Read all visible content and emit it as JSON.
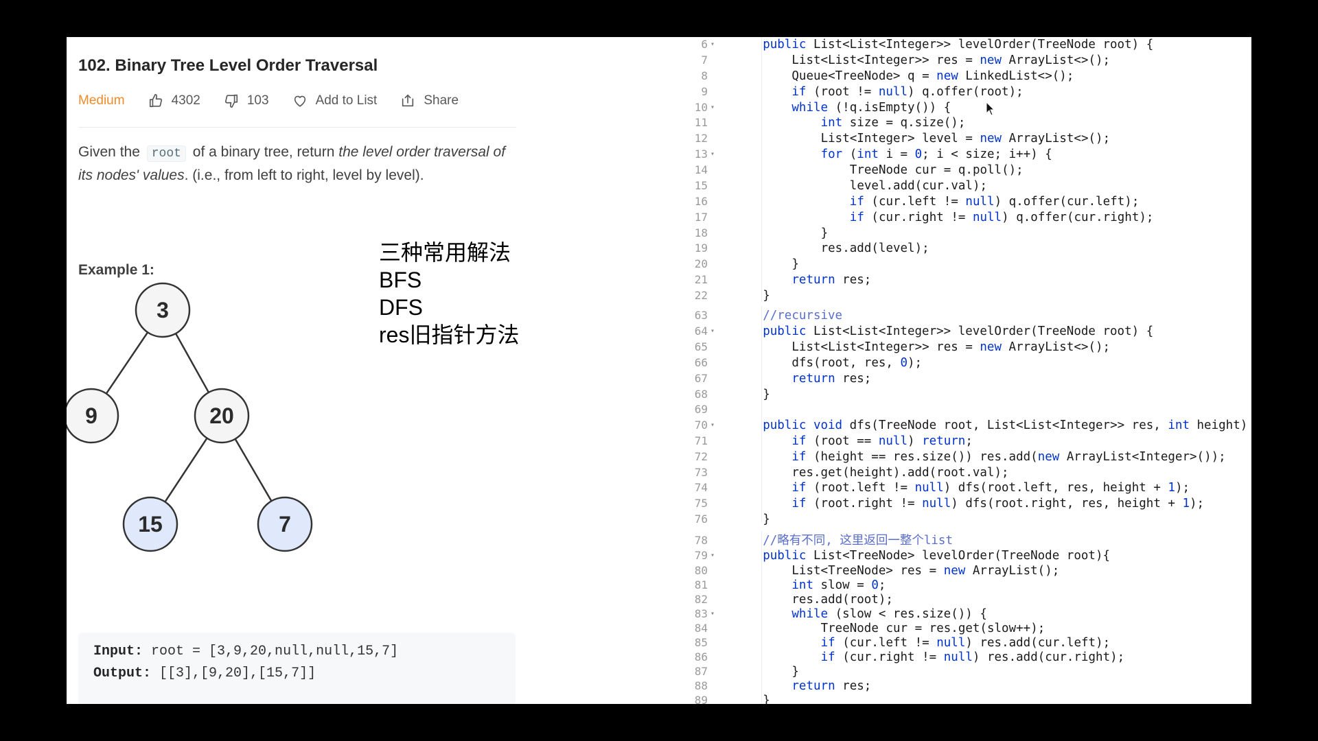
{
  "problem": {
    "title": "102. Binary Tree Level Order Traversal",
    "difficulty": "Medium",
    "likes": "4302",
    "dislikes": "103",
    "add_to_list": "Add to List",
    "share": "Share",
    "desc_1": "Given the",
    "desc_code": "root",
    "desc_2": "of a binary tree, return",
    "desc_italic": "the level order traversal of its nodes' values",
    "desc_3": ". (i.e., from left to right, level by level).",
    "example_label": "Example 1:",
    "input_label": "Input:",
    "input_value": "root = [3,9,20,null,null,15,7]",
    "output_label": "Output:",
    "output_value": "[[3],[9,20],[15,7]]"
  },
  "note": {
    "lines": [
      "三种常用解法",
      "BFS",
      "DFS",
      "res旧指针方法"
    ]
  },
  "tree": {
    "nodes": [
      {
        "value": "3",
        "highlight": false
      },
      {
        "value": "9",
        "highlight": false
      },
      {
        "value": "20",
        "highlight": false
      },
      {
        "value": "15",
        "highlight": true
      },
      {
        "value": "7",
        "highlight": true
      }
    ],
    "edges": [
      [
        0,
        1
      ],
      [
        0,
        2
      ],
      [
        2,
        3
      ],
      [
        2,
        4
      ]
    ],
    "node_fill": "#f5f5f5",
    "highlight_fill": "#dfe9fb",
    "edge_color": "#333333"
  },
  "code": {
    "colors": {
      "keyword": "#0033cc",
      "comment": "#5a6ecc",
      "line_number": "#9a9a9a"
    },
    "lines": [
      {
        "n": "6",
        "fold": true,
        "indent": 4,
        "text": "public List<List<Integer>> levelOrder(TreeNode root) {"
      },
      {
        "n": "7",
        "fold": false,
        "indent": 8,
        "text": "List<List<Integer>> res = new ArrayList<>();"
      },
      {
        "n": "8",
        "fold": false,
        "indent": 8,
        "text": "Queue<TreeNode> q = new LinkedList<>();"
      },
      {
        "n": "9",
        "fold": false,
        "indent": 8,
        "text": "if (root != null) q.offer(root);"
      },
      {
        "n": "10",
        "fold": true,
        "indent": 8,
        "text": "while (!q.isEmpty()) {"
      },
      {
        "n": "11",
        "fold": false,
        "indent": 12,
        "text": "int size = q.size();"
      },
      {
        "n": "12",
        "fold": false,
        "indent": 12,
        "text": "List<Integer> level = new ArrayList<>();"
      },
      {
        "n": "13",
        "fold": true,
        "indent": 12,
        "text": "for (int i = 0; i < size; i++) {"
      },
      {
        "n": "14",
        "fold": false,
        "indent": 16,
        "text": "TreeNode cur = q.poll();"
      },
      {
        "n": "15",
        "fold": false,
        "indent": 16,
        "text": "level.add(cur.val);"
      },
      {
        "n": "16",
        "fold": false,
        "indent": 16,
        "text": "if (cur.left != null) q.offer(cur.left);"
      },
      {
        "n": "17",
        "fold": false,
        "indent": 16,
        "text": "if (cur.right != null) q.offer(cur.right);"
      },
      {
        "n": "18",
        "fold": false,
        "indent": 12,
        "text": "}"
      },
      {
        "n": "19",
        "fold": false,
        "indent": 12,
        "text": "res.add(level);"
      },
      {
        "n": "20",
        "fold": false,
        "indent": 8,
        "text": "}"
      },
      {
        "n": "21",
        "fold": false,
        "indent": 8,
        "text": "return res;"
      },
      {
        "n": "22",
        "fold": false,
        "indent": 4,
        "text": "}"
      },
      {
        "n": "63",
        "fold": false,
        "indent": 4,
        "text": "//recursive"
      },
      {
        "n": "64",
        "fold": true,
        "indent": 4,
        "text": "public List<List<Integer>> levelOrder(TreeNode root) {"
      },
      {
        "n": "65",
        "fold": false,
        "indent": 8,
        "text": "List<List<Integer>> res = new ArrayList<>();"
      },
      {
        "n": "66",
        "fold": false,
        "indent": 8,
        "text": "dfs(root, res, 0);"
      },
      {
        "n": "67",
        "fold": false,
        "indent": 8,
        "text": "return res;"
      },
      {
        "n": "68",
        "fold": false,
        "indent": 4,
        "text": "}"
      },
      {
        "n": "69",
        "fold": false,
        "indent": 0,
        "text": ""
      },
      {
        "n": "70",
        "fold": true,
        "indent": 4,
        "text": "public void dfs(TreeNode root, List<List<Integer>> res, int height) {"
      },
      {
        "n": "71",
        "fold": false,
        "indent": 8,
        "text": "if (root == null) return;"
      },
      {
        "n": "72",
        "fold": false,
        "indent": 8,
        "text": "if (height == res.size()) res.add(new ArrayList<Integer>());"
      },
      {
        "n": "73",
        "fold": false,
        "indent": 8,
        "text": "res.get(height).add(root.val);"
      },
      {
        "n": "74",
        "fold": false,
        "indent": 8,
        "text": "if (root.left != null) dfs(root.left, res, height + 1);"
      },
      {
        "n": "75",
        "fold": false,
        "indent": 8,
        "text": "if (root.right != null) dfs(root.right, res, height + 1);"
      },
      {
        "n": "76",
        "fold": false,
        "indent": 4,
        "text": "}"
      },
      {
        "n": "78",
        "fold": false,
        "indent": 4,
        "text": "//略有不同, 这里返回一整个list"
      },
      {
        "n": "79",
        "fold": true,
        "indent": 4,
        "text": "public List<TreeNode> levelOrder(TreeNode root){"
      },
      {
        "n": "80",
        "fold": false,
        "indent": 8,
        "text": "List<TreeNode> res = new ArrayList();"
      },
      {
        "n": "81",
        "fold": false,
        "indent": 8,
        "text": "int slow = 0;"
      },
      {
        "n": "82",
        "fold": false,
        "indent": 8,
        "text": "res.add(root);"
      },
      {
        "n": "83",
        "fold": true,
        "indent": 8,
        "text": "while (slow < res.size()) {"
      },
      {
        "n": "84",
        "fold": false,
        "indent": 12,
        "text": "TreeNode cur = res.get(slow++);"
      },
      {
        "n": "85",
        "fold": false,
        "indent": 12,
        "text": "if (cur.left != null) res.add(cur.left);"
      },
      {
        "n": "86",
        "fold": false,
        "indent": 12,
        "text": "if (cur.right != null) res.add(cur.right);"
      },
      {
        "n": "87",
        "fold": false,
        "indent": 8,
        "text": "}"
      },
      {
        "n": "88",
        "fold": false,
        "indent": 8,
        "text": "return res;"
      },
      {
        "n": "89",
        "fold": false,
        "indent": 4,
        "text": "}"
      }
    ]
  }
}
